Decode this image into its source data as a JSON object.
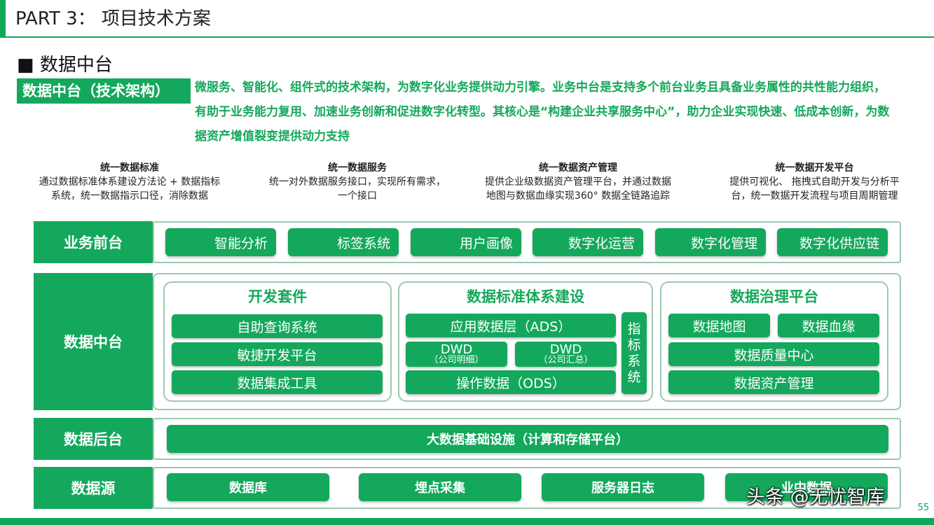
{
  "header": {
    "title": "PART 3：  项目技术方案",
    "subtitle": "■ 数据中台"
  },
  "arch": {
    "label": "数据中台（技术架构）",
    "intro": "微服务、智能化、组件式的技术架构，为数字化业务提供动力引擎。业务中台是支持多个前台业务且具备业务属性的共性能力组织，有助于业务能力复用、加速业务创新和促进数字化转型。其核心是“构建企业共享服务中心”，助力企业实现快速、低成本创新，为数据资产增值裂变提供动力支持"
  },
  "unified": [
    {
      "title": "统一数据标准",
      "desc": "通过数据标准体系建设方法论 + 数据指标系统，统一数据指示口径，消除数据"
    },
    {
      "title": "统一数据服务",
      "desc": "统一对外数据服务接口，实现所有需求，一个接口"
    },
    {
      "title": "统一数据资产管理",
      "desc": "提供企业级数据资产管理平台，并通过数据地图与数据血缘实现360° 数据全链路追踪"
    },
    {
      "title": "统一数据开发平台",
      "desc": "提供可视化、 拖拽式自助开发与分析平台，统一数据开发流程与项目周期管理"
    }
  ],
  "layers": {
    "front": {
      "label": "业务前台",
      "items": [
        "智能分析",
        "标签系统",
        "用户画像",
        "数字化运营",
        "数字化管理",
        "数字化供应链"
      ]
    },
    "middle": {
      "label": "数据中台",
      "dev_kit": {
        "title": "开发套件",
        "items": [
          "自助查询系统",
          "敏捷开发平台",
          "数据集成工具"
        ]
      },
      "standard": {
        "title": "数据标准体系建设",
        "ads": "应用数据层（ADS）",
        "dwd_detail": {
          "name": "DWD",
          "sub": "（公司明细）"
        },
        "dwd_summary": {
          "name": "DWD",
          "sub": "（公司汇总）"
        },
        "ods": "操作数据（ODS）",
        "indicator": "指标系统"
      },
      "governance": {
        "title": "数据治理平台",
        "items": [
          "数据地图",
          "数据血缘",
          "数据质量中心",
          "数据资产管理"
        ]
      }
    },
    "back": {
      "label": "数据后台",
      "item": "大数据基础设施（计算和存储平台）"
    },
    "source": {
      "label": "数据源",
      "items": [
        "数据库",
        "埋点采集",
        "服务器日志",
        "业中数据"
      ]
    }
  },
  "footer": {
    "page": "55",
    "watermark": "头条 @无忧智库"
  },
  "colors": {
    "brand": "#14a85c",
    "frame": "#9bc9ad"
  }
}
